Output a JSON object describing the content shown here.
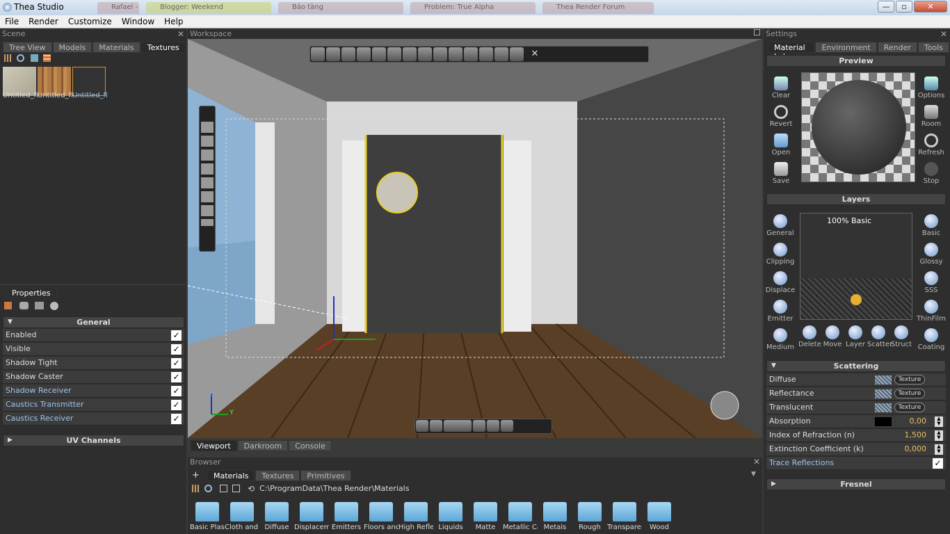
{
  "window": {
    "title": "Thea Studio",
    "min": "—",
    "max": "▫",
    "close": "✕"
  },
  "background_tabs": [
    "Rafael - Modeling an",
    "Blogger: Weekend",
    "Bảo tàng",
    "Problem: True Alpha",
    "Thea Render Forum"
  ],
  "menu": [
    "File",
    "Render",
    "Customize",
    "Window",
    "Help"
  ],
  "scene": {
    "title": "Scene",
    "tabs": [
      "Tree View",
      "Models",
      "Materials",
      "Textures"
    ],
    "active_tab": "Textures",
    "thumbs": [
      "Untitled_file",
      "Untitled_file",
      "Untitled_file"
    ]
  },
  "properties": {
    "title": "Properties",
    "general_label": "General",
    "rows": [
      {
        "label": "Enabled",
        "checked": true
      },
      {
        "label": "Visible",
        "checked": true
      },
      {
        "label": "Shadow Tight",
        "checked": true
      },
      {
        "label": "Shadow Caster",
        "checked": true
      },
      {
        "label": "Shadow Receiver",
        "checked": true
      },
      {
        "label": "Caustics Transmitter",
        "checked": true
      },
      {
        "label": "Caustics Receiver",
        "checked": true
      }
    ],
    "uv_label": "UV Channels",
    "check": "✓"
  },
  "workspace": {
    "title": "Workspace",
    "tabs": [
      "Viewport",
      "Darkroom",
      "Console"
    ],
    "axis_z": "Z",
    "axis_y": "Y",
    "toolbar_close": "✕"
  },
  "browser": {
    "title": "Browser",
    "tabs": [
      "Materials",
      "Textures",
      "Primitives"
    ],
    "path": "C:\\ProgramData\\Thea Render\\Materials",
    "folders": [
      "Basic Plastic",
      "Cloth and L",
      "Diffuse",
      "Displaceme",
      "Emitters",
      "Floors and",
      "High Reflec",
      "Liquids",
      "Matte",
      "Metallic Car",
      "Metals",
      "Rough",
      "Transparent",
      "Wood"
    ]
  },
  "settings": {
    "title": "Settings",
    "tabs": [
      "Material Lab",
      "Environment",
      "Render",
      "Tools"
    ],
    "preview_label": "Preview",
    "left_buttons": [
      "Clear",
      "Revert",
      "Open",
      "Save"
    ],
    "right_buttons": [
      "Options",
      "Room",
      "Refresh",
      "Stop"
    ],
    "layers_label": "Layers",
    "layer_name": "100% Basic",
    "layer_left": [
      "General",
      "Clipping",
      "Displace",
      "Emitter",
      "Medium"
    ],
    "layer_right": [
      "Basic",
      "Glossy",
      "SSS",
      "ThinFilm",
      "Coating"
    ],
    "layer_bottom": [
      "Delete",
      "Move",
      "Layer",
      "Scatter",
      "Struct"
    ],
    "scattering_label": "Scattering",
    "texture_label": "Texture",
    "rows": [
      {
        "label": "Diffuse",
        "type": "texture"
      },
      {
        "label": "Reflectance",
        "type": "texture"
      },
      {
        "label": "Translucent",
        "type": "texture"
      },
      {
        "label": "Absorption",
        "type": "value",
        "value": "0,00"
      },
      {
        "label": "Index of Refraction (n)",
        "type": "value",
        "value": "1,500"
      },
      {
        "label": "Extinction Coefficient (k)",
        "type": "value",
        "value": "0,000"
      },
      {
        "label": "Trace Reflections",
        "type": "check"
      }
    ],
    "fresnel_label": "Fresnel"
  }
}
